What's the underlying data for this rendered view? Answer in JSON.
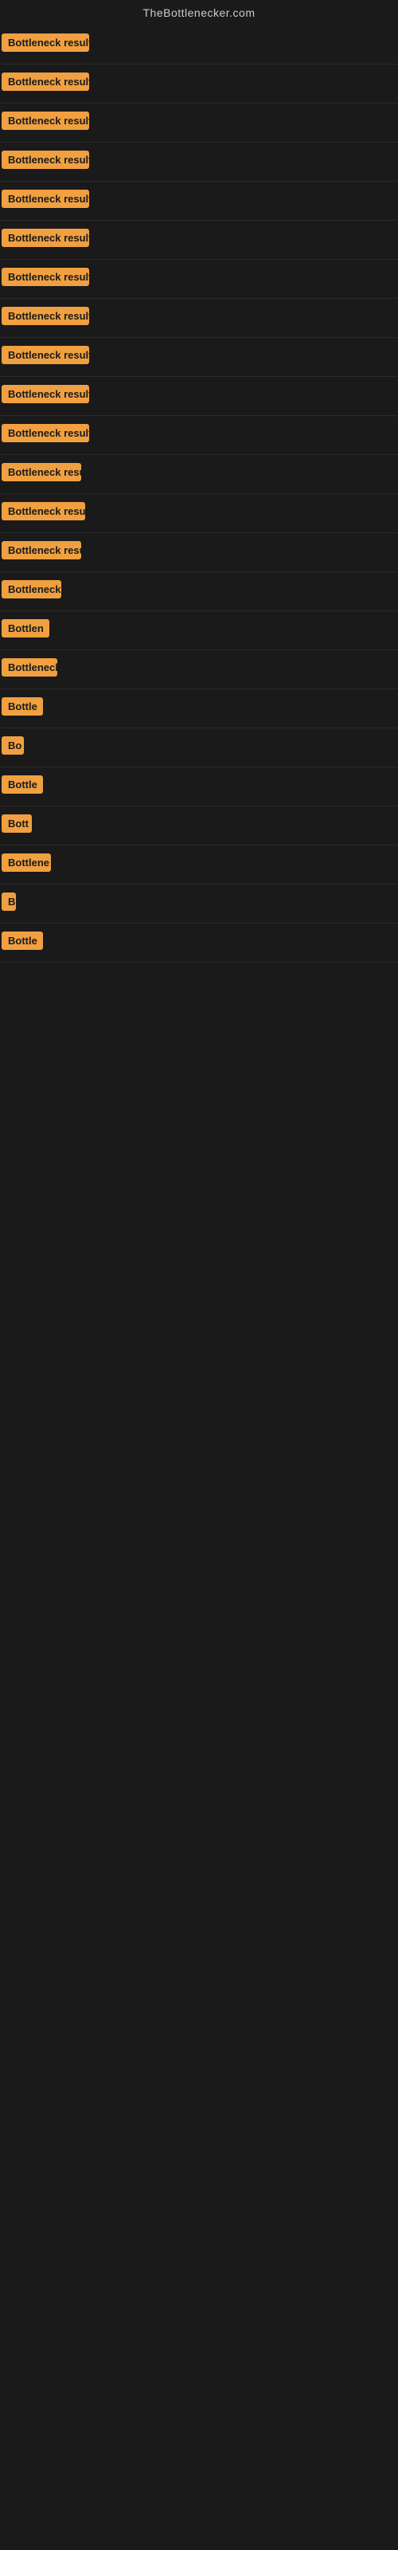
{
  "site": {
    "title": "TheBottlenecker.com"
  },
  "rows": [
    {
      "id": 1,
      "label": "Bottleneck result",
      "width": 110
    },
    {
      "id": 2,
      "label": "Bottleneck result",
      "width": 110
    },
    {
      "id": 3,
      "label": "Bottleneck result",
      "width": 110
    },
    {
      "id": 4,
      "label": "Bottleneck result",
      "width": 110
    },
    {
      "id": 5,
      "label": "Bottleneck result",
      "width": 110
    },
    {
      "id": 6,
      "label": "Bottleneck result",
      "width": 110
    },
    {
      "id": 7,
      "label": "Bottleneck result",
      "width": 110
    },
    {
      "id": 8,
      "label": "Bottleneck result",
      "width": 110
    },
    {
      "id": 9,
      "label": "Bottleneck result",
      "width": 110
    },
    {
      "id": 10,
      "label": "Bottleneck result",
      "width": 110
    },
    {
      "id": 11,
      "label": "Bottleneck result",
      "width": 110
    },
    {
      "id": 12,
      "label": "Bottleneck resul",
      "width": 100
    },
    {
      "id": 13,
      "label": "Bottleneck result",
      "width": 105
    },
    {
      "id": 14,
      "label": "Bottleneck result",
      "width": 100
    },
    {
      "id": 15,
      "label": "Bottleneck r",
      "width": 75
    },
    {
      "id": 16,
      "label": "Bottlen",
      "width": 60
    },
    {
      "id": 17,
      "label": "Bottleneck",
      "width": 70
    },
    {
      "id": 18,
      "label": "Bottle",
      "width": 52
    },
    {
      "id": 19,
      "label": "Bo",
      "width": 28
    },
    {
      "id": 20,
      "label": "Bottle",
      "width": 52
    },
    {
      "id": 21,
      "label": "Bott",
      "width": 38
    },
    {
      "id": 22,
      "label": "Bottlene",
      "width": 62
    },
    {
      "id": 23,
      "label": "B",
      "width": 18
    },
    {
      "id": 24,
      "label": "Bottle",
      "width": 52
    }
  ],
  "colors": {
    "badge_bg": "#f0a040",
    "badge_text": "#1a1a1a",
    "background": "#1a1a1a",
    "title": "#cccccc"
  }
}
